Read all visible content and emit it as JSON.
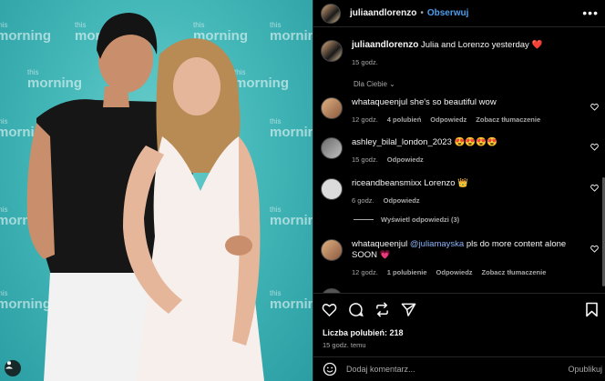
{
  "photo": {
    "watermarks": [
      "this morning",
      "this morning",
      "this morning",
      "morning",
      "morning",
      "morning",
      "morning",
      "morning",
      "morning"
    ]
  },
  "header": {
    "username": "juliaandlorenzo",
    "separator": "•",
    "follow_label": "Obserwuj",
    "more_icon": "more-horizontal-icon"
  },
  "caption": {
    "username": "juliaandlorenzo",
    "text": "Julia and Lorenzo yesterday",
    "emoji": "❤️",
    "time": "15 godz."
  },
  "section_label": "Dla Ciebie",
  "comments": [
    {
      "username": "whataqueenjul",
      "text": "she's so beautiful wow",
      "time": "12 godz.",
      "likes": "4 polubień",
      "reply": "Odpowiedz",
      "translate": "Zobacz tłumaczenie"
    },
    {
      "username": "ashley_bilal_london_2023",
      "text": "😍😍😍😍",
      "time": "15 godz.",
      "reply": "Odpowiedz"
    },
    {
      "username": "riceandbeansmixx",
      "text": "Lorenzo 👑",
      "time": "6 godz.",
      "reply": "Odpowiedz"
    },
    {
      "username": "whataqueenjul",
      "mention": "@juliamayska",
      "text": "pls do more content alone SOON",
      "emoji": "💗",
      "time": "12 godz.",
      "likes": "1 polubienie",
      "reply": "Odpowiedz",
      "translate": "Zobacz tłumaczenie"
    }
  ],
  "view_replies": "Wyświetl odpowiedzi (3)",
  "actions": {
    "likes": "Liczba polubień: 218",
    "time_ago": "15 godz. temu"
  },
  "add_comment": {
    "placeholder": "Dodaj komentarz...",
    "publish": "Opublikuj"
  },
  "colors": {
    "accent": "#4c9eeb",
    "muted": "#a8a8a8",
    "bg": "#000000",
    "photo_bg": "#45b8b9"
  }
}
